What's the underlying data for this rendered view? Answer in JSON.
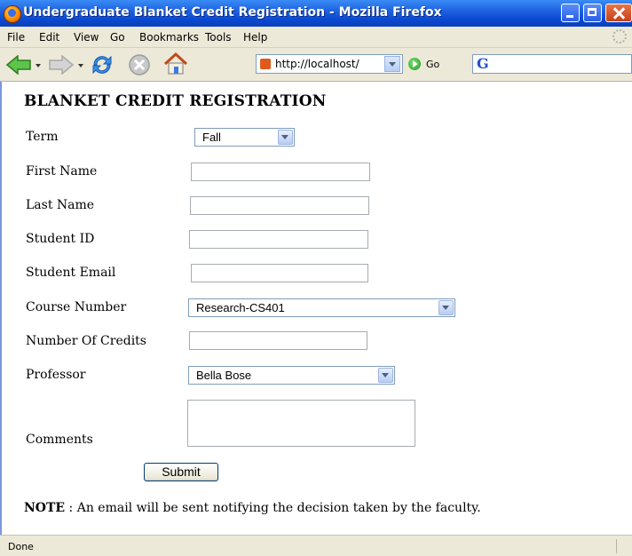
{
  "window": {
    "title": "Undergraduate Blanket Credit Registration - Mozilla Firefox"
  },
  "menu": [
    "File",
    "Edit",
    "View",
    "Go",
    "Bookmarks",
    "Tools",
    "Help"
  ],
  "toolbar": {
    "url": "http://localhost/",
    "go_label": "Go",
    "search_logo": "G"
  },
  "page": {
    "title": "BLANKET CREDIT REGISTRATION",
    "fields": {
      "term_label": "Term",
      "term_value": "Fall",
      "first_name_label": "First Name",
      "first_name_value": "",
      "last_name_label": "Last Name",
      "last_name_value": "",
      "student_id_label": "Student ID",
      "student_id_value": "",
      "email_label": "Student Email",
      "email_value": "",
      "course_label": "Course Number",
      "course_value": "Research-CS401",
      "credits_label": "Number Of Credits",
      "credits_value": "",
      "professor_label": "Professor",
      "professor_value": "Bella Bose",
      "comments_label": "Comments"
    },
    "submit_label": "Submit",
    "note_bold": "NOTE",
    "note_text": " : An email will be sent notifying the decision taken by the faculty."
  },
  "status": {
    "text": "Done"
  },
  "icons": {
    "back": "back-arrow-icon",
    "forward": "forward-arrow-icon",
    "reload": "reload-icon",
    "stop": "stop-icon",
    "home": "home-icon"
  },
  "colors": {
    "titlebar": "#0a48d0",
    "chrome": "#ece9d8",
    "go_green": "#1d9a1a"
  }
}
